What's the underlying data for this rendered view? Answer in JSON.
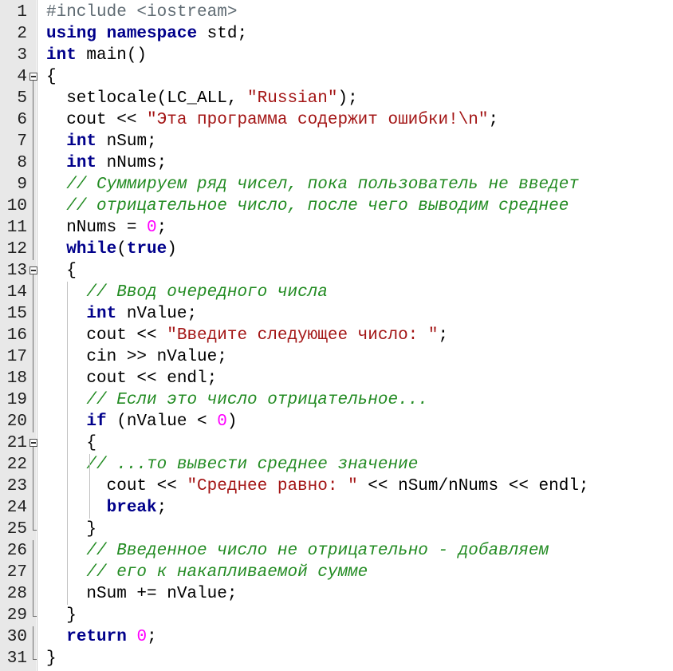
{
  "lines": [
    {
      "num": "1",
      "tokens": [
        {
          "c": "p",
          "t": "#include <iostream>"
        }
      ]
    },
    {
      "num": "2",
      "tokens": [
        {
          "c": "k",
          "t": "using"
        },
        {
          "c": "t",
          "t": " "
        },
        {
          "c": "k",
          "t": "namespace"
        },
        {
          "c": "t",
          "t": " std;"
        }
      ]
    },
    {
      "num": "3",
      "tokens": [
        {
          "c": "k",
          "t": "int"
        },
        {
          "c": "t",
          "t": " main()"
        }
      ]
    },
    {
      "num": "4",
      "tokens": [
        {
          "c": "t",
          "t": "{"
        }
      ]
    },
    {
      "num": "5",
      "tokens": [
        {
          "c": "t",
          "t": "  setlocale(LC_ALL, "
        },
        {
          "c": "s",
          "t": "\"Russian\""
        },
        {
          "c": "t",
          "t": ");"
        }
      ]
    },
    {
      "num": "6",
      "tokens": [
        {
          "c": "t",
          "t": "  cout << "
        },
        {
          "c": "s",
          "t": "\"Эта программа содержит ошибки!\\n\""
        },
        {
          "c": "t",
          "t": ";"
        }
      ]
    },
    {
      "num": "7",
      "tokens": [
        {
          "c": "t",
          "t": "  "
        },
        {
          "c": "k",
          "t": "int"
        },
        {
          "c": "t",
          "t": " nSum;"
        }
      ]
    },
    {
      "num": "8",
      "tokens": [
        {
          "c": "t",
          "t": "  "
        },
        {
          "c": "k",
          "t": "int"
        },
        {
          "c": "t",
          "t": " nNums;"
        }
      ]
    },
    {
      "num": "9",
      "tokens": [
        {
          "c": "t",
          "t": "  "
        },
        {
          "c": "c",
          "t": "// Суммируем ряд чисел, пока пользователь не введет"
        }
      ]
    },
    {
      "num": "10",
      "tokens": [
        {
          "c": "t",
          "t": "  "
        },
        {
          "c": "c",
          "t": "// отрицательное число, после чего выводим среднее"
        }
      ]
    },
    {
      "num": "11",
      "tokens": [
        {
          "c": "t",
          "t": "  nNums = "
        },
        {
          "c": "n",
          "t": "0"
        },
        {
          "c": "t",
          "t": ";"
        }
      ]
    },
    {
      "num": "12",
      "tokens": [
        {
          "c": "t",
          "t": "  "
        },
        {
          "c": "k",
          "t": "while"
        },
        {
          "c": "t",
          "t": "("
        },
        {
          "c": "k",
          "t": "true"
        },
        {
          "c": "t",
          "t": ")"
        }
      ]
    },
    {
      "num": "13",
      "tokens": [
        {
          "c": "t",
          "t": "  {"
        }
      ]
    },
    {
      "num": "14",
      "tokens": [
        {
          "c": "t",
          "t": "    "
        },
        {
          "c": "c",
          "t": "// Ввод очередного числа"
        }
      ]
    },
    {
      "num": "15",
      "tokens": [
        {
          "c": "t",
          "t": "    "
        },
        {
          "c": "k",
          "t": "int"
        },
        {
          "c": "t",
          "t": " nValue;"
        }
      ]
    },
    {
      "num": "16",
      "tokens": [
        {
          "c": "t",
          "t": "    cout << "
        },
        {
          "c": "s",
          "t": "\"Введите следующее число: \""
        },
        {
          "c": "t",
          "t": ";"
        }
      ]
    },
    {
      "num": "17",
      "tokens": [
        {
          "c": "t",
          "t": "    cin >> nValue;"
        }
      ]
    },
    {
      "num": "18",
      "tokens": [
        {
          "c": "t",
          "t": "    cout << endl;"
        }
      ]
    },
    {
      "num": "19",
      "tokens": [
        {
          "c": "t",
          "t": "    "
        },
        {
          "c": "c",
          "t": "// Если это число отрицательное..."
        }
      ]
    },
    {
      "num": "20",
      "tokens": [
        {
          "c": "t",
          "t": "    "
        },
        {
          "c": "k",
          "t": "if"
        },
        {
          "c": "t",
          "t": " (nValue < "
        },
        {
          "c": "n",
          "t": "0"
        },
        {
          "c": "t",
          "t": ")"
        }
      ]
    },
    {
      "num": "21",
      "tokens": [
        {
          "c": "t",
          "t": "    {"
        }
      ]
    },
    {
      "num": "22",
      "tokens": [
        {
          "c": "t",
          "t": "    "
        },
        {
          "c": "c",
          "t": "// ...то вывести среднее значение"
        }
      ]
    },
    {
      "num": "23",
      "tokens": [
        {
          "c": "t",
          "t": "      cout << "
        },
        {
          "c": "s",
          "t": "\"Среднее равно: \""
        },
        {
          "c": "t",
          "t": " << nSum/nNums << endl;"
        }
      ]
    },
    {
      "num": "24",
      "tokens": [
        {
          "c": "t",
          "t": "      "
        },
        {
          "c": "k",
          "t": "break"
        },
        {
          "c": "t",
          "t": ";"
        }
      ]
    },
    {
      "num": "25",
      "tokens": [
        {
          "c": "t",
          "t": "    }"
        }
      ]
    },
    {
      "num": "26",
      "tokens": [
        {
          "c": "t",
          "t": "    "
        },
        {
          "c": "c",
          "t": "// Введенное число не отрицательно - добавляем"
        }
      ]
    },
    {
      "num": "27",
      "tokens": [
        {
          "c": "t",
          "t": "    "
        },
        {
          "c": "c",
          "t": "// его к накапливаемой сумме"
        }
      ]
    },
    {
      "num": "28",
      "tokens": [
        {
          "c": "t",
          "t": "    nSum += nValue;"
        }
      ]
    },
    {
      "num": "29",
      "tokens": [
        {
          "c": "t",
          "t": "  }"
        }
      ]
    },
    {
      "num": "30",
      "tokens": [
        {
          "c": "t",
          "t": "  "
        },
        {
          "c": "k",
          "t": "return"
        },
        {
          "c": "t",
          "t": " "
        },
        {
          "c": "n",
          "t": "0"
        },
        {
          "c": "t",
          "t": ";"
        }
      ]
    },
    {
      "num": "31",
      "tokens": [
        {
          "c": "t",
          "t": "}"
        }
      ]
    }
  ],
  "folds": {
    "4": "box",
    "13": "box",
    "21": "box",
    "25": "end",
    "29": "end",
    "31": "end"
  },
  "colors": {
    "keyword": "#00008b",
    "string": "#a31515",
    "comment": "#228b22",
    "number": "#ff00ff",
    "preprocessor": "#5f6b73",
    "gutter": "#e8e8e8"
  }
}
